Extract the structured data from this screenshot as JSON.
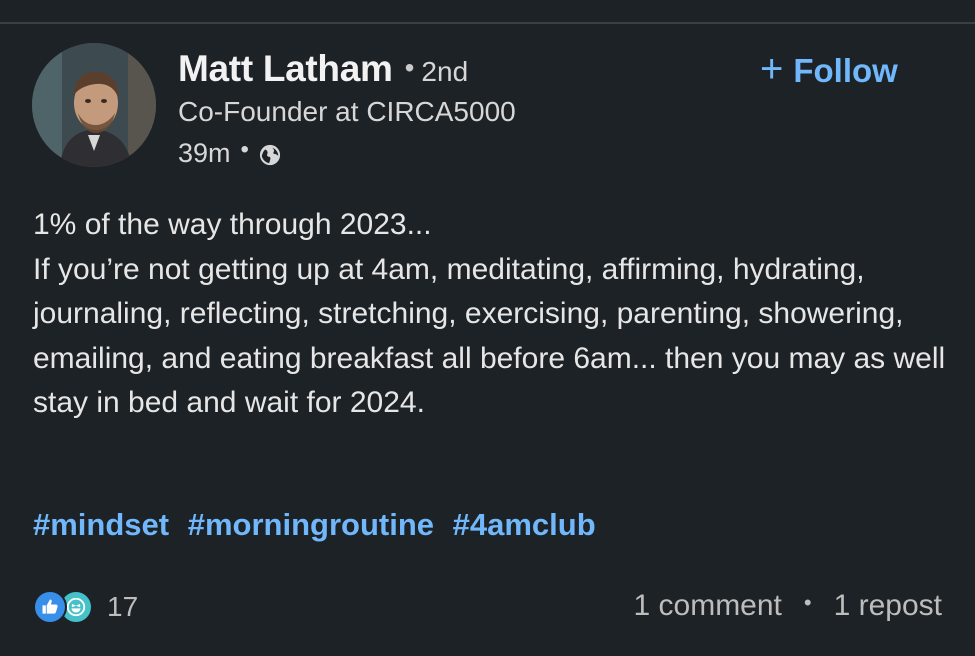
{
  "author": {
    "name": "Matt Latham",
    "degree": "2nd",
    "headline": "Co-Founder at CIRCA5000",
    "time_ago": "39m",
    "visibility_icon": "globe-icon"
  },
  "follow": {
    "label": "Follow",
    "icon": "plus-icon"
  },
  "post": {
    "text": "1% of the way through 2023...\nIf you’re not getting up at 4am, meditating, affirming, hydrating, journaling, reflecting, stretching, exercising, parenting, showering, emailing, and eating breakfast all before 6am... then you may as well stay in bed and wait for 2024.",
    "hashtags": [
      "#mindset",
      "#morningroutine",
      "#4amclub"
    ]
  },
  "social": {
    "reaction_count": "17",
    "reaction_icons": [
      "like-icon",
      "funny-icon"
    ],
    "comments": "1 comment",
    "reposts": "1 repost"
  },
  "colors": {
    "background": "#1d2226",
    "link_blue": "#71b7fb",
    "like_blue": "#378fe9",
    "funny_teal": "#44c1c9"
  }
}
